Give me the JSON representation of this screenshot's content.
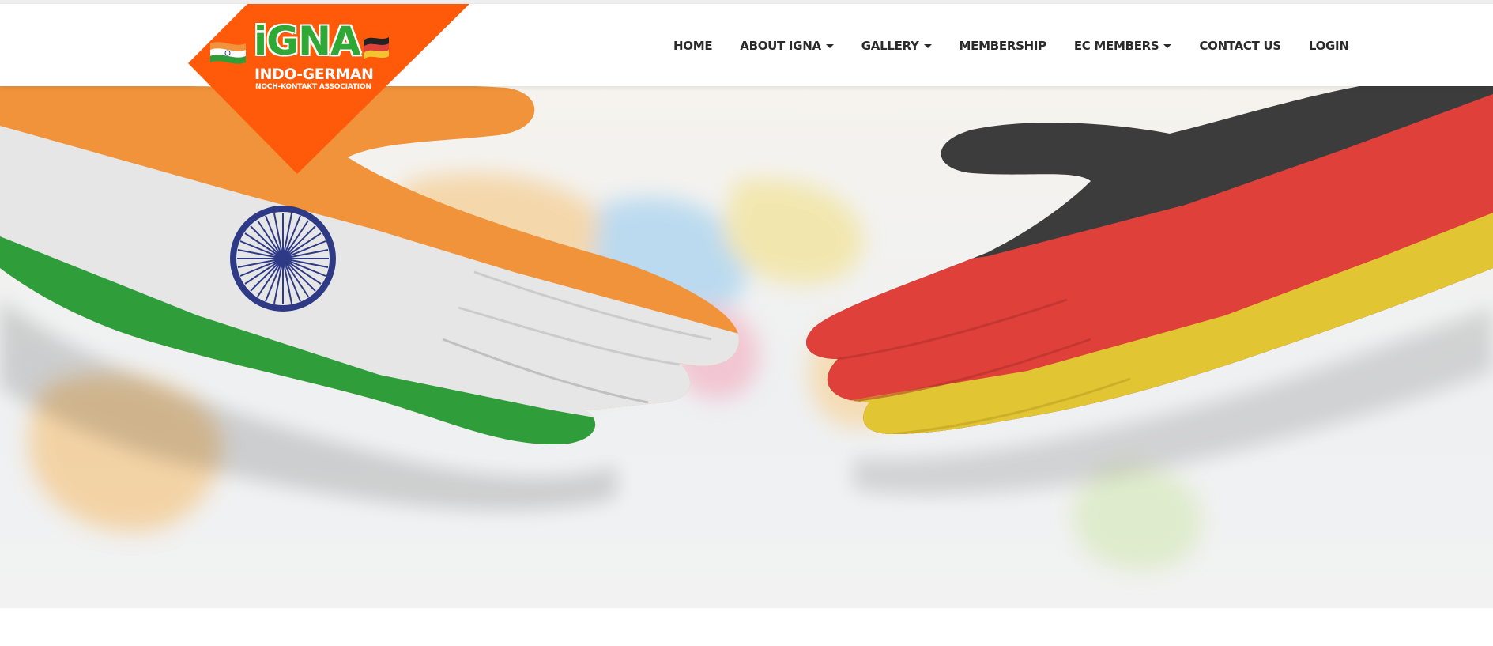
{
  "brand": {
    "logo_main": "iGNA",
    "logo_sub": "INDO-GERMAN",
    "logo_tagline": "NOCH-KONTAKT ASSOCIATION",
    "logo_color": "#ff5a0a"
  },
  "nav": {
    "items": [
      {
        "label": "HOME",
        "dropdown": false
      },
      {
        "label": "ABOUT IGNA",
        "dropdown": true
      },
      {
        "label": "GALLERY",
        "dropdown": true
      },
      {
        "label": "MEMBERSHIP",
        "dropdown": false
      },
      {
        "label": "EC MEMBERS",
        "dropdown": true
      },
      {
        "label": "CONTACT US",
        "dropdown": false
      },
      {
        "label": "LOGIN",
        "dropdown": false
      }
    ]
  },
  "hero": {
    "image": "handshake-india-germany-flags",
    "colors": {
      "saffron": "#f0933a",
      "india_white": "#e6e6e6",
      "india_green": "#2f9e3a",
      "chakra": "#2f3a86",
      "german_black": "#3c3c3c",
      "german_red": "#e0403a",
      "german_gold": "#e2c532"
    }
  }
}
